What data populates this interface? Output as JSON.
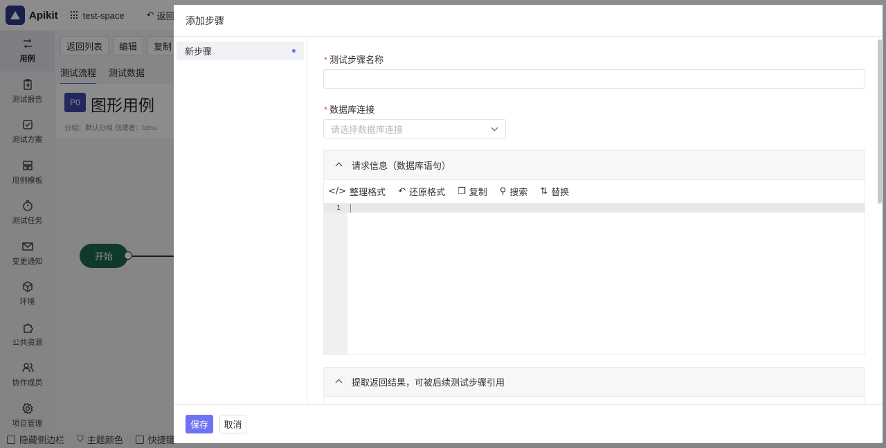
{
  "app": {
    "name": "Apikit",
    "space": "test-space",
    "back_label": "返回"
  },
  "sidebar": {
    "items": [
      {
        "label": "用例",
        "icon": "cases-icon"
      },
      {
        "label": "测试报告",
        "icon": "report-icon"
      },
      {
        "label": "测试方案",
        "icon": "plan-icon"
      },
      {
        "label": "用例模板",
        "icon": "template-icon"
      },
      {
        "label": "测试任务",
        "icon": "timer-icon"
      },
      {
        "label": "变更通知",
        "icon": "mail-icon"
      },
      {
        "label": "环境",
        "icon": "cube-icon"
      },
      {
        "label": "公共资源",
        "icon": "puzzle-icon"
      },
      {
        "label": "协作成员",
        "icon": "members-icon"
      },
      {
        "label": "项目管理",
        "icon": "gear-icon"
      }
    ]
  },
  "toolbar": {
    "back_list": "返回列表",
    "edit": "编辑",
    "copy": "复制"
  },
  "tabs": {
    "flow": "测试流程",
    "data": "测试数据"
  },
  "case": {
    "priority": "P0",
    "title": "图形用例",
    "meta": "分组：默认分组      创建者：lizhu"
  },
  "canvas": {
    "start": "开始"
  },
  "bottombar": {
    "hide_sidebar": "隐藏侧边栏",
    "theme": "主题颜色",
    "shortcut": "快捷键"
  },
  "modal": {
    "title": "添加步骤",
    "step_name": "新步骤",
    "field_name_label": "测试步骤名称",
    "field_db_label": "数据库连接",
    "db_placeholder": "请选择数据库连接",
    "panel_request_title": "请求信息（数据库语句）",
    "editor_tools": {
      "format": "整理格式",
      "restore": "还原格式",
      "copy": "复制",
      "search": "搜索",
      "replace": "替换"
    },
    "line_number": "1",
    "panel_extract_title": "提取返回结果，可被后续测试步骤引用",
    "save": "保存",
    "cancel": "取消"
  },
  "colors": {
    "accent": "#6e73f5",
    "brand": "#2d3a8c",
    "start_node": "#1c6b4a",
    "required": "#e5533d"
  }
}
